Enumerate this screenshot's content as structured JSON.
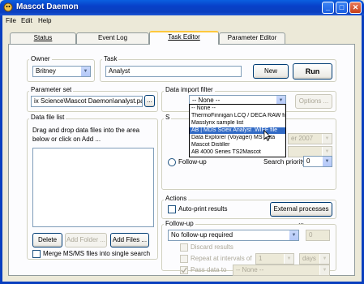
{
  "window": {
    "title": "Mascot Daemon"
  },
  "menu": [
    "File",
    "Edit",
    "Help"
  ],
  "tabs": [
    {
      "label": "Status"
    },
    {
      "label": "Event Log"
    },
    {
      "label": "Task Editor"
    },
    {
      "label": "Parameter Editor"
    }
  ],
  "owner": {
    "label": "Owner",
    "value": "Britney"
  },
  "task": {
    "label": "Task",
    "value": "Analyst",
    "new_label": "New",
    "run_label": "Run"
  },
  "parameter_set": {
    "label": "Parameter set",
    "value": "ix Science\\Mascot Daemon\\analyst.par",
    "browse_label": "..."
  },
  "data_import": {
    "label": "Data import filter",
    "value": "-- None --",
    "options_label": "Options ...",
    "dropdown_items": [
      "-- None --",
      "ThermoFinnigan LCQ / DECA RAW file",
      "Masslynx sample list",
      "AB | MDS Sciex Analyst .WIFF file",
      "Data Explorer (Voyager) MS data",
      "Mascot Distiller",
      "AB 4000 Series TS2Mascot"
    ],
    "selected_index": 3
  },
  "data_file_list": {
    "label": "Data file list",
    "hint": "Drag and drop data files into the area below or click on Add ...",
    "delete_label": "Delete",
    "add_folder_label": "Add Folder ...",
    "add_files_label": "Add Files ...",
    "merge_label": "Merge MS/MS files into single search"
  },
  "schedule": {
    "label_partial": "S",
    "date_value": "er  2007",
    "follow_up_label": "Follow-up",
    "search_priority_label": "Search priority",
    "search_priority_value": "0"
  },
  "actions": {
    "label": "Actions",
    "auto_print_label": "Auto-print results",
    "external_label": "External processes ..."
  },
  "follow_up": {
    "label": "Follow-up",
    "value": "No follow-up required",
    "count_value": "0",
    "discard_label": "Discard results",
    "repeat_label": "Repeat at intervals of",
    "repeat_value": "1",
    "unit_value": "days",
    "pass_label": "Pass data to",
    "pass_value": "-- None --"
  }
}
